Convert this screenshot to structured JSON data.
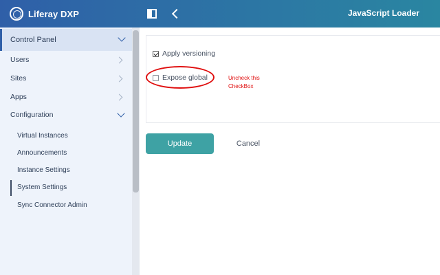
{
  "header": {
    "brand": "Liferay DXP",
    "title": "JavaScript Loader"
  },
  "sidebar": {
    "section": "Control Panel",
    "items": [
      {
        "label": "Users"
      },
      {
        "label": "Sites"
      },
      {
        "label": "Apps"
      },
      {
        "label": "Configuration"
      }
    ],
    "sub_items": [
      {
        "label": "Virtual Instances"
      },
      {
        "label": "Announcements"
      },
      {
        "label": "Instance Settings"
      },
      {
        "label": "System Settings",
        "active": true
      },
      {
        "label": "Sync Connector Admin"
      }
    ]
  },
  "form": {
    "apply_versioning": {
      "label": "Apply versioning",
      "checked": true
    },
    "expose_global": {
      "label": "Expose global",
      "checked": false
    }
  },
  "annotation": {
    "line1": "Uncheck this",
    "line2": "CheckBox",
    "color": "#e01010"
  },
  "actions": {
    "update": "Update",
    "cancel": "Cancel"
  },
  "colors": {
    "header_start": "#2f5fa8",
    "header_end": "#2a86a1",
    "primary_button": "#3ea2a4"
  }
}
